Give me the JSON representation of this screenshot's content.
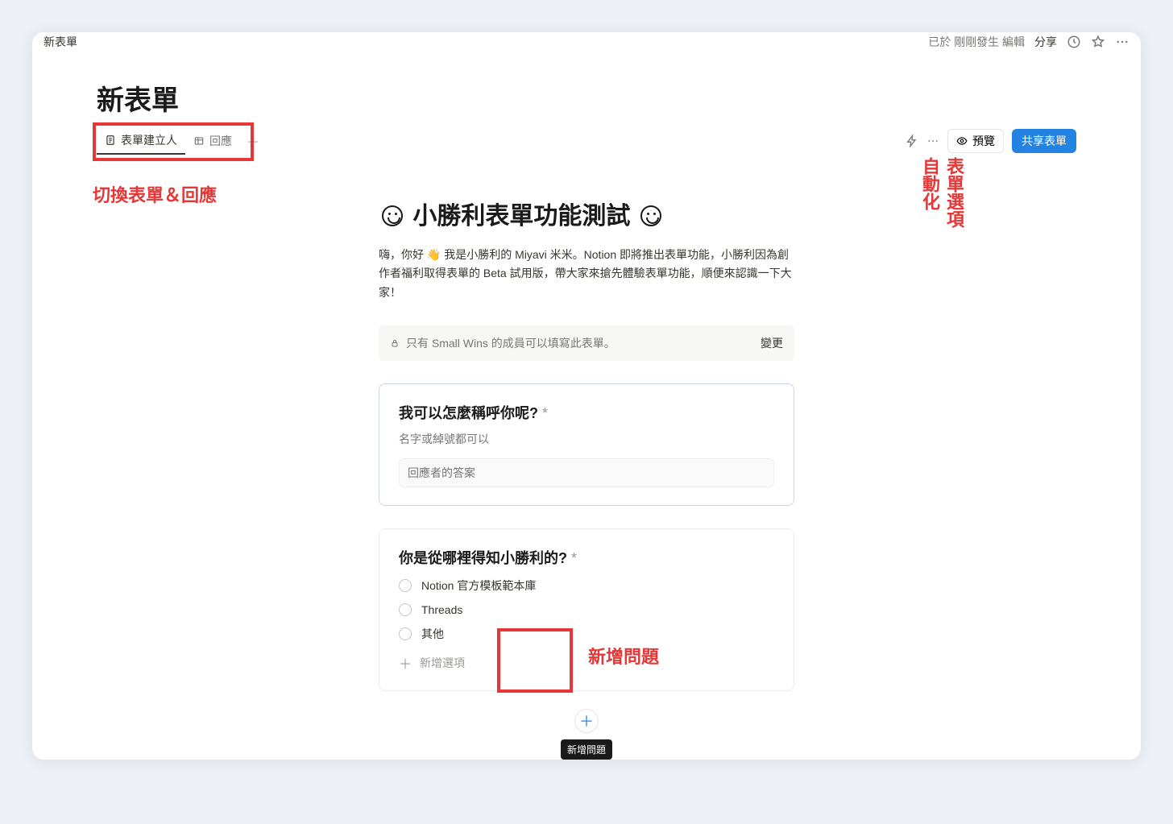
{
  "topbar": {
    "breadcrumb": "新表單",
    "edited_label": "已於 剛剛發生 編輯",
    "share_label": "分享"
  },
  "page": {
    "title": "新表單"
  },
  "tabs": {
    "builder": "表單建立人",
    "responses": "回應"
  },
  "actions": {
    "preview": "預覽",
    "share_form": "共享表單"
  },
  "annotations": {
    "switch_tabs": "切換表單＆回應",
    "automation": "自動化",
    "form_options": "表單選項",
    "add_question": "新增問題"
  },
  "form": {
    "title_text": "小勝利表單功能測試",
    "description": "嗨，你好 👋 我是小勝利的 Miyavi 米米。Notion 即將推出表單功能，小勝利因為創作者福利取得表單的 Beta 試用版，帶大家來搶先體驗表單功能，順便來認識一下大家！",
    "access_text": "只有 Small Wins 的成員可以填寫此表單。",
    "access_change": "變更"
  },
  "questions": [
    {
      "title": "我可以怎麼稱呼你呢?",
      "required_mark": "*",
      "subtitle": "名字或綽號都可以",
      "placeholder": "回應者的答案"
    },
    {
      "title": "你是從哪裡得知小勝利的?",
      "required_mark": "*",
      "options": [
        "Notion 官方模板範本庫",
        "Threads",
        "其他"
      ],
      "add_option_label": "新增選項"
    }
  ],
  "add_question_tooltip": "新增問題"
}
